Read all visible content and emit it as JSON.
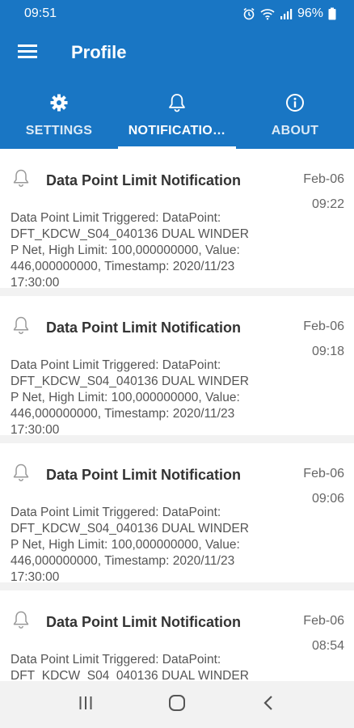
{
  "status_bar": {
    "time": "09:51",
    "battery": "96%"
  },
  "app_bar": {
    "title": "Profile"
  },
  "tabs": [
    {
      "label": "SETTINGS",
      "icon": "gear-icon",
      "active": false
    },
    {
      "label": "NOTIFICATIO…",
      "icon": "bell-icon",
      "active": true
    },
    {
      "label": "ABOUT",
      "icon": "info-icon",
      "active": false
    }
  ],
  "notifications": [
    {
      "title": "Data Point Limit Notification",
      "date": "Feb-06",
      "time": "09:22",
      "lines": [
        "Data Point Limit Triggered: DataPoint:",
        "DFT_KDCW_S04_040136 DUAL WINDER",
        "P Net, High Limit: 100,000000000, Value:",
        "446,000000000, Timestamp: 2020/11/23",
        "17:30:00"
      ]
    },
    {
      "title": "Data Point Limit Notification",
      "date": "Feb-06",
      "time": "09:18",
      "lines": [
        "Data Point Limit Triggered: DataPoint:",
        "DFT_KDCW_S04_040136 DUAL WINDER",
        "P Net, High Limit: 100,000000000, Value:",
        "446,000000000, Timestamp: 2020/11/23",
        "17:30:00"
      ]
    },
    {
      "title": "Data Point Limit Notification",
      "date": "Feb-06",
      "time": "09:06",
      "lines": [
        "Data Point Limit Triggered: DataPoint:",
        "DFT_KDCW_S04_040136 DUAL WINDER",
        "P Net, High Limit: 100,000000000, Value:",
        "446,000000000, Timestamp: 2020/11/23",
        "17:30:00"
      ]
    },
    {
      "title": "Data Point Limit Notification",
      "date": "Feb-06",
      "time": "08:54",
      "lines": [
        "Data Point Limit Triggered: DataPoint:",
        "DFT_KDCW_S04_040136 DUAL WINDER"
      ]
    }
  ],
  "colors": {
    "primary": "#1976c4",
    "background": "#f2f2f2",
    "card": "#ffffff"
  }
}
